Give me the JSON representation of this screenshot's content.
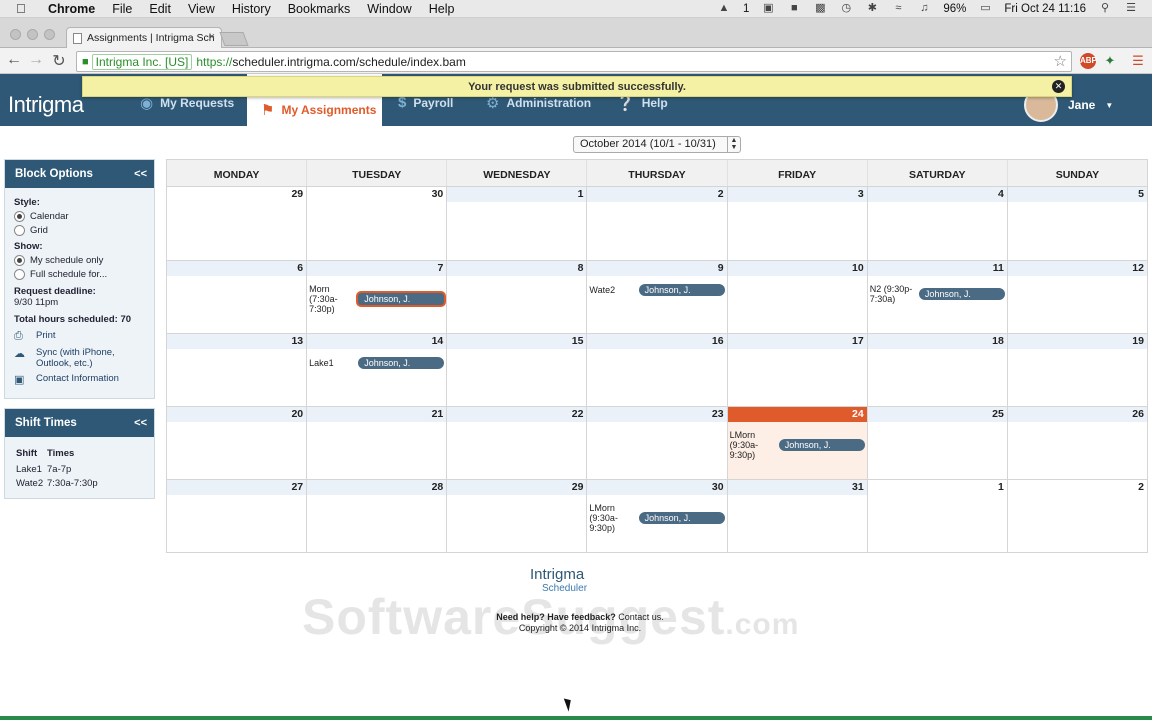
{
  "macbar": {
    "apple": "",
    "menus": [
      "Chrome",
      "File",
      "Edit",
      "View",
      "History",
      "Bookmarks",
      "Window",
      "Help"
    ],
    "status_badge": "1",
    "battery": "96%",
    "datetime": "Fri Oct 24  11:16"
  },
  "browser": {
    "tab_title": "Assignments | Intrigma Sch",
    "org": "Intrigma Inc. [US]",
    "url_scheme": "https://",
    "url_rest": "scheduler.intrigma.com/schedule/index.bam"
  },
  "app": {
    "logo": "Intrigma",
    "nav": [
      {
        "label": "My Requests"
      },
      {
        "label": "My Assignments"
      },
      {
        "label": "Payroll"
      },
      {
        "label": "Administration"
      },
      {
        "label": "Help"
      }
    ],
    "user_name": "Jane"
  },
  "alert": {
    "message": "Your request was submitted successfully."
  },
  "month_select": "October 2014 (10/1 - 10/31)",
  "block_options": {
    "title": "Block Options",
    "collapse": "<<",
    "style_label": "Style:",
    "style_calendar": "Calendar",
    "style_grid": "Grid",
    "show_label": "Show:",
    "show_mine": "My schedule only",
    "show_full": "Full schedule for...",
    "deadline_label": "Request deadline:",
    "deadline_value": "9/30 11pm",
    "total_hours": "Total hours scheduled: 70",
    "print": "Print",
    "sync": "Sync (with iPhone, Outlook, etc.)",
    "contact": "Contact Information"
  },
  "shift_times": {
    "title": "Shift Times",
    "collapse": "<<",
    "headers": [
      "Shift",
      "Times"
    ],
    "rows": [
      [
        "Lake1",
        "7a-7p"
      ],
      [
        "Wate2",
        "7:30a-7:30p"
      ]
    ]
  },
  "calendar": {
    "headers": [
      "MONDAY",
      "TUESDAY",
      "WEDNESDAY",
      "THURSDAY",
      "FRIDAY",
      "SATURDAY",
      "SUNDAY"
    ],
    "weeks": [
      [
        "29",
        "30",
        "1",
        "2",
        "3",
        "4",
        "5"
      ],
      [
        "6",
        "7",
        "8",
        "9",
        "10",
        "11",
        "12"
      ],
      [
        "13",
        "14",
        "15",
        "16",
        "17",
        "18",
        "19"
      ],
      [
        "20",
        "21",
        "22",
        "23",
        "24",
        "25",
        "26"
      ],
      [
        "27",
        "28",
        "29",
        "30",
        "31",
        "1",
        "2"
      ]
    ],
    "events": {
      "w1d1": {
        "shift": "Morn (7:30a-7:30p)",
        "who": "Johnson, J."
      },
      "w1d3": {
        "shift": "Wate2",
        "who": "Johnson, J."
      },
      "w1d5": {
        "shift": "N2 (9:30p-7:30a)",
        "who": "Johnson, J."
      },
      "w2d1": {
        "shift": "Lake1",
        "who": "Johnson, J."
      },
      "w3d4": {
        "shift": "LMorn (9:30a-9:30p)",
        "who": "Johnson, J."
      },
      "w4d3": {
        "shift": "LMorn (9:30a-9:30p)",
        "who": "Johnson, J."
      }
    }
  },
  "footer": {
    "logo": "Intrigma",
    "logo_sub": "Scheduler",
    "help_bold": "Need help? Have feedback?",
    "help_link": "Contact us.",
    "copyright": "Copyright © 2014 Intrigma Inc."
  },
  "watermark": {
    "main": "SoftwareSuggest",
    "suffix": ".com"
  },
  "colors": {
    "brand": "#2f5876",
    "accent": "#e05b2b",
    "alert": "#f4f1a4"
  }
}
